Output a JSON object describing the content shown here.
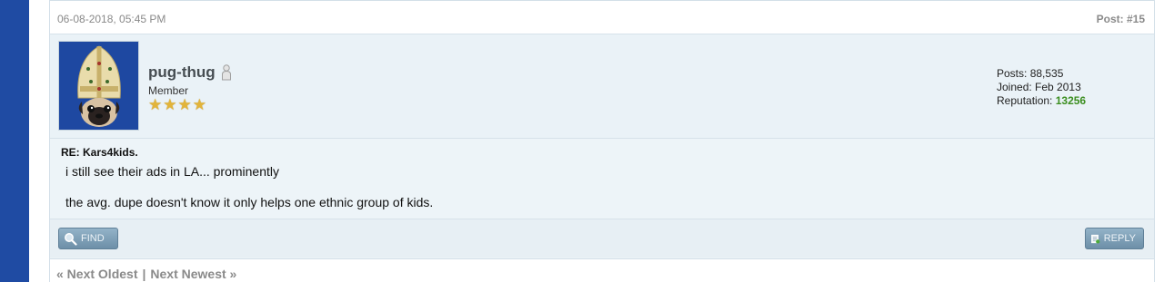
{
  "post": {
    "date": "06-08-2018, 05:45 PM",
    "number": "Post: #15"
  },
  "author": {
    "username": "pug-thug",
    "title": "Member",
    "stars": 4,
    "posts_label": "Posts:",
    "posts_value": "88,535",
    "joined_label": "Joined:",
    "joined_value": "Feb 2013",
    "rep_label": "Reputation:",
    "rep_value": "13256",
    "rep_color": "#3b8e1f"
  },
  "body": {
    "subject": "RE: Kars4kids.",
    "line1": "i still see their ads in LA... prominently",
    "line2": "the avg. dupe doesn't know it only helps one ethnic group of kids."
  },
  "buttons": {
    "find": "FIND",
    "reply": "REPLY"
  },
  "pager": {
    "prev": "« Next Oldest",
    "sep": "|",
    "next": "Next Newest »"
  },
  "colors": {
    "sidebar": "#1f4ba3",
    "post_bg": "#ecf3f7",
    "button": "#7f9fb6"
  }
}
